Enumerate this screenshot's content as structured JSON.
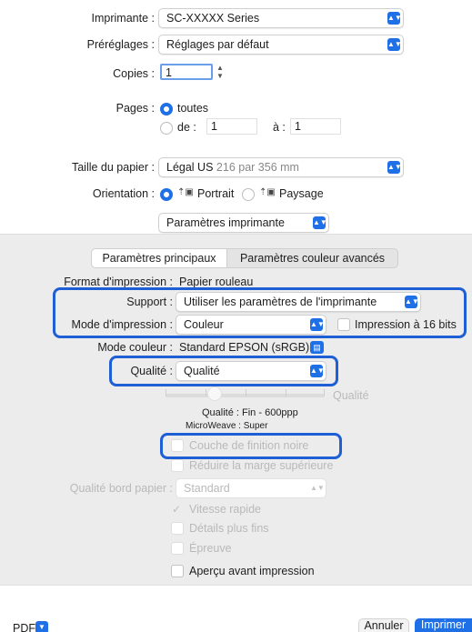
{
  "printer": {
    "label": "Imprimante :",
    "value": "SC-XXXXX Series"
  },
  "presets": {
    "label": "Préréglages :",
    "value": "Réglages par défaut"
  },
  "copies": {
    "label": "Copies :",
    "value": "1"
  },
  "pages": {
    "label": "Pages :",
    "all_label": "toutes",
    "from_label": "de :",
    "from_value": "1",
    "to_label": "à :",
    "to_value": "1"
  },
  "paper_size": {
    "label": "Taille du papier :",
    "value": "Légal US",
    "detail": "216 par 356 mm"
  },
  "orientation": {
    "label": "Orientation :",
    "portrait": "Portrait",
    "landscape": "Paysage"
  },
  "section_popup": {
    "value": "Paramètres imprimante"
  },
  "tabs": {
    "main": "Paramètres principaux",
    "color": "Paramètres couleur avancés"
  },
  "print_format": {
    "label": "Format d'impression :",
    "value": "Papier rouleau"
  },
  "media": {
    "label": "Support :",
    "value": "Utiliser les paramètres de l'imprimante"
  },
  "print_mode": {
    "label": "Mode d'impression :",
    "value": "Couleur",
    "bit16_label": "Impression à 16 bits"
  },
  "color_mode": {
    "label": "Mode couleur :",
    "value": "Standard EPSON (sRGB)"
  },
  "quality": {
    "label": "Qualité :",
    "value": "Qualité",
    "slider_label": "Qualité",
    "detail": "Qualité : Fin - 600ppp",
    "microweave": "MicroWeave : Super"
  },
  "options": {
    "black_overcoat": "Couche de finition noire",
    "reduce_top_margin": "Réduire la marge supérieure",
    "paper_edge_label": "Qualité bord papier :",
    "paper_edge_value": "Standard",
    "high_speed": "Vitesse rapide",
    "finest_detail": "Détails plus fins",
    "proof": "Épreuve",
    "preview": "Aperçu avant impression"
  },
  "footer": {
    "pdf": "PDF",
    "cancel": "Annuler",
    "print": "Imprimer"
  },
  "colors": {
    "accent": "#1f6fe6",
    "highlight": "#1f5fd6"
  }
}
